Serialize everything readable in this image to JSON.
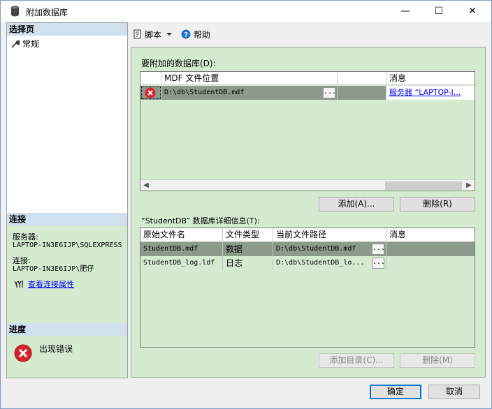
{
  "window": {
    "title": "附加数据库",
    "minimize_glyph": "—",
    "maximize_glyph": "☐",
    "close_glyph": "✕"
  },
  "sidebar": {
    "select_page_header": "选择页",
    "pages": [
      {
        "label": "常规",
        "icon": "wrench-icon"
      }
    ],
    "connection_header": "连接",
    "server_label": "服务器:",
    "server_value": "LAPTOP-IN3E6IJP\\SQLEXPRESS",
    "connection_label": "连接:",
    "connection_value": "LAPTOP-IN3E6IJP\\肥仔",
    "view_connection_properties": "查看连接属性",
    "progress_header": "进度",
    "progress_status": "出现错误"
  },
  "toolbar": {
    "script_label": "脚本",
    "help_label": "帮助"
  },
  "databases_section": {
    "label": "要附加的数据库(D):",
    "columns": [
      "",
      "MDF 文件位置",
      "",
      "消息"
    ],
    "rows": [
      {
        "status_icon": "error-icon",
        "mdf_path": "D:\\db\\StudentDB.mdf",
        "browse": "...",
        "message": "服务器 “LAPTOP-I..."
      }
    ],
    "add_button": "添加(A)...",
    "remove_button": "删除(R)"
  },
  "details_section": {
    "label": "“StudentDB” 数据库详细信息(T):",
    "columns": [
      "原始文件名",
      "文件类型",
      "当前文件路径",
      "消息"
    ],
    "rows": [
      {
        "original_name": "StudentDB.mdf",
        "file_type": "数据",
        "current_path": "D:\\db\\StudentDB.mdf",
        "browse": "...",
        "message": ""
      },
      {
        "original_name": "StudentDB_log.ldf",
        "file_type": "日志",
        "current_path": "D:\\db\\StudentDB_lo...",
        "browse": "...",
        "message": ""
      }
    ],
    "add_catalog_button": "添加目录(C)...",
    "remove_button": "删除(M)"
  },
  "footer": {
    "ok_button": "确定",
    "cancel_button": "取消"
  },
  "colors": {
    "green_panel": "#d4ebd0",
    "header_blue": "#cfe0ee",
    "selected_row": "#8c9a8c",
    "error_red": "#d9232c",
    "link_blue": "#0000ee"
  }
}
